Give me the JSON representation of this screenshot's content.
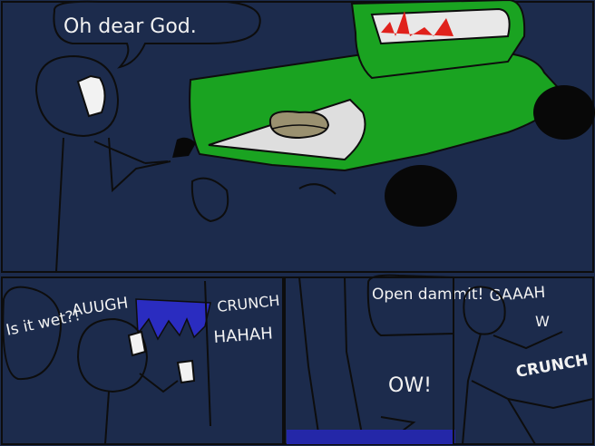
{
  "comic": {
    "panel_top": {
      "speech": "Oh dear God."
    },
    "panel_bottom_left": {
      "speech": "Is it wet?!",
      "shout": "AUUGH",
      "sfx_crunch": "CRUNCH",
      "sfx_hahah": "HAHAH"
    },
    "panel_bottom_middle": {
      "speech": "Open dammit!",
      "sfx_ow": "OW!"
    },
    "panel_bottom_right": {
      "shout": "GAAAH",
      "shout2": "W",
      "sfx_crunch": "CRUNCH"
    },
    "colors": {
      "background": "#1c2b4c",
      "car_green": "#1aa321",
      "blood_red": "#e0211b",
      "ink": "#0d0d0d",
      "flood_blue": "#2a2cc0",
      "floor_blue": "#2427a8"
    }
  }
}
